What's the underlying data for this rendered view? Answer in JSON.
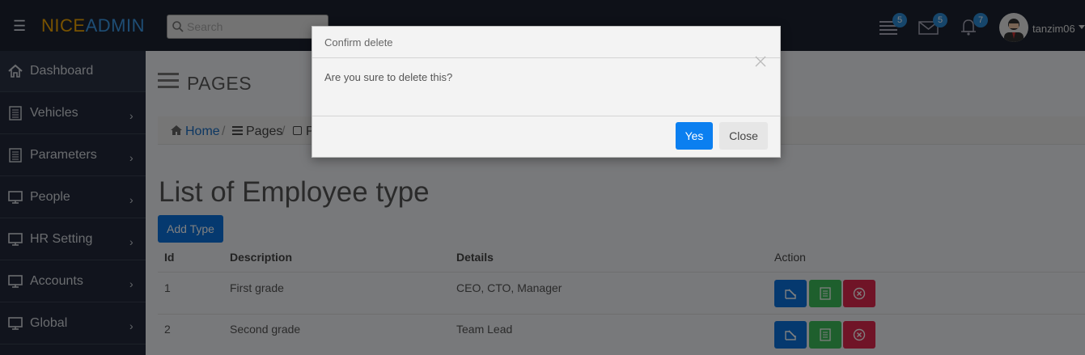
{
  "header": {
    "brand_part1": "NICE",
    "brand_part2": "ADMIN",
    "search_placeholder": "Search",
    "badges": {
      "tasks": "5",
      "messages": "5",
      "notifications": "7"
    },
    "username": "tanzim06"
  },
  "sidebar": {
    "items": [
      {
        "label": "Dashboard",
        "icon": "home-icon"
      },
      {
        "label": "Vehicles",
        "icon": "document-icon"
      },
      {
        "label": "Parameters",
        "icon": "document-icon"
      },
      {
        "label": "People",
        "icon": "monitor-icon"
      },
      {
        "label": "HR Setting",
        "icon": "monitor-icon"
      },
      {
        "label": "Accounts",
        "icon": "monitor-icon"
      },
      {
        "label": "Global",
        "icon": "monitor-icon"
      }
    ]
  },
  "page": {
    "title": "PAGES",
    "breadcrumb": {
      "home": "Home",
      "pages": "Pages",
      "current": "P"
    },
    "list_title": "List of Employee type",
    "add_button": "Add Type"
  },
  "table": {
    "headers": {
      "id": "Id",
      "description": "Description",
      "details": "Details",
      "action": "Action"
    },
    "rows": [
      {
        "id": "1",
        "description": "First grade",
        "details": "CEO, CTO, Manager"
      },
      {
        "id": "2",
        "description": "Second grade",
        "details": "Team Lead"
      }
    ]
  },
  "modal": {
    "title": "Confirm delete",
    "message": "Are you sure to delete this?",
    "yes_label": "Yes",
    "close_label": "Close"
  },
  "colors": {
    "header_bg": "#1c2331",
    "sidebar_bg": "#22293a",
    "primary": "#0b73de",
    "success": "#3cbf5a",
    "danger": "#e0284f",
    "badge": "#2d8cd6",
    "brand_accent": "#f0a500"
  }
}
